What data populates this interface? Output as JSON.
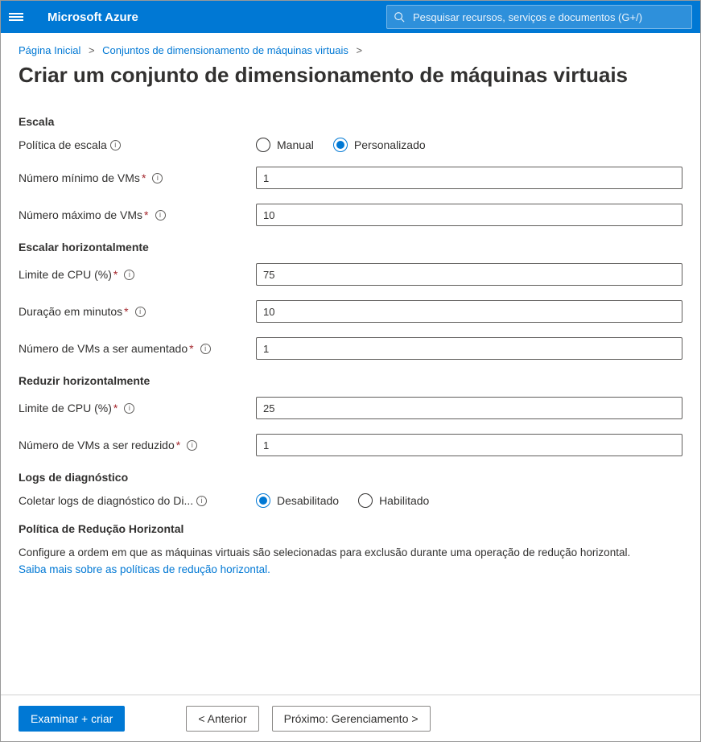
{
  "header": {
    "brand": "Microsoft Azure",
    "search_placeholder": "Pesquisar recursos, serviços e documentos (G+/)"
  },
  "breadcrumb": {
    "home": "Página Inicial",
    "parent": "Conjuntos de dimensionamento de máquinas virtuais"
  },
  "page": {
    "title": "Criar um conjunto de dimensionamento de máquinas virtuais"
  },
  "sections": {
    "scale": {
      "heading": "Escala",
      "policy_label": "Política de escala",
      "policy_options": {
        "manual": "Manual",
        "custom": "Personalizado"
      },
      "policy_selected": "custom",
      "min_vms_label": "Número mínimo de VMs",
      "min_vms_value": "1",
      "max_vms_label": "Número máximo de VMs",
      "max_vms_value": "10"
    },
    "scale_out": {
      "heading": "Escalar horizontalmente",
      "cpu_label": "Limite de CPU (%)",
      "cpu_value": "75",
      "duration_label": "Duração em minutos",
      "duration_value": "10",
      "increase_label": "Número de VMs a ser aumentado",
      "increase_value": "1"
    },
    "scale_in": {
      "heading": "Reduzir horizontalmente",
      "cpu_label": "Limite de CPU (%)",
      "cpu_value": "25",
      "decrease_label": "Número de VMs a ser reduzido",
      "decrease_value": "1"
    },
    "diag": {
      "heading": "Logs de diagnóstico",
      "collect_label": "Coletar logs de diagnóstico do Di...",
      "options": {
        "disabled": "Desabilitado",
        "enabled": "Habilitado"
      },
      "selected": "disabled"
    },
    "scalein_policy": {
      "heading": "Política de Redução Horizontal",
      "desc": "Configure a ordem em que as máquinas virtuais são selecionadas para exclusão durante uma operação de redução horizontal.",
      "link": "Saiba mais sobre as políticas de redução horizontal."
    }
  },
  "footer": {
    "review": "Examinar + criar",
    "previous": "< Anterior",
    "next": "Próximo: Gerenciamento >"
  }
}
